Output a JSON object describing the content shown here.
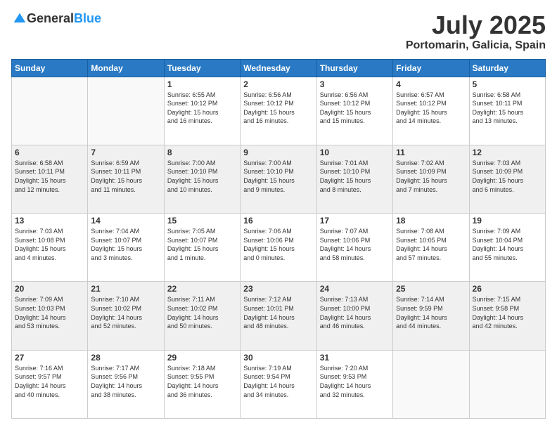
{
  "header": {
    "logo_general": "General",
    "logo_blue": "Blue",
    "month": "July 2025",
    "location": "Portomarin, Galicia, Spain"
  },
  "days_of_week": [
    "Sunday",
    "Monday",
    "Tuesday",
    "Wednesday",
    "Thursday",
    "Friday",
    "Saturday"
  ],
  "weeks": [
    [
      {
        "day": "",
        "info": ""
      },
      {
        "day": "",
        "info": ""
      },
      {
        "day": "1",
        "info": "Sunrise: 6:55 AM\nSunset: 10:12 PM\nDaylight: 15 hours\nand 16 minutes."
      },
      {
        "day": "2",
        "info": "Sunrise: 6:56 AM\nSunset: 10:12 PM\nDaylight: 15 hours\nand 16 minutes."
      },
      {
        "day": "3",
        "info": "Sunrise: 6:56 AM\nSunset: 10:12 PM\nDaylight: 15 hours\nand 15 minutes."
      },
      {
        "day": "4",
        "info": "Sunrise: 6:57 AM\nSunset: 10:12 PM\nDaylight: 15 hours\nand 14 minutes."
      },
      {
        "day": "5",
        "info": "Sunrise: 6:58 AM\nSunset: 10:11 PM\nDaylight: 15 hours\nand 13 minutes."
      }
    ],
    [
      {
        "day": "6",
        "info": "Sunrise: 6:58 AM\nSunset: 10:11 PM\nDaylight: 15 hours\nand 12 minutes."
      },
      {
        "day": "7",
        "info": "Sunrise: 6:59 AM\nSunset: 10:11 PM\nDaylight: 15 hours\nand 11 minutes."
      },
      {
        "day": "8",
        "info": "Sunrise: 7:00 AM\nSunset: 10:10 PM\nDaylight: 15 hours\nand 10 minutes."
      },
      {
        "day": "9",
        "info": "Sunrise: 7:00 AM\nSunset: 10:10 PM\nDaylight: 15 hours\nand 9 minutes."
      },
      {
        "day": "10",
        "info": "Sunrise: 7:01 AM\nSunset: 10:10 PM\nDaylight: 15 hours\nand 8 minutes."
      },
      {
        "day": "11",
        "info": "Sunrise: 7:02 AM\nSunset: 10:09 PM\nDaylight: 15 hours\nand 7 minutes."
      },
      {
        "day": "12",
        "info": "Sunrise: 7:03 AM\nSunset: 10:09 PM\nDaylight: 15 hours\nand 6 minutes."
      }
    ],
    [
      {
        "day": "13",
        "info": "Sunrise: 7:03 AM\nSunset: 10:08 PM\nDaylight: 15 hours\nand 4 minutes."
      },
      {
        "day": "14",
        "info": "Sunrise: 7:04 AM\nSunset: 10:07 PM\nDaylight: 15 hours\nand 3 minutes."
      },
      {
        "day": "15",
        "info": "Sunrise: 7:05 AM\nSunset: 10:07 PM\nDaylight: 15 hours\nand 1 minute."
      },
      {
        "day": "16",
        "info": "Sunrise: 7:06 AM\nSunset: 10:06 PM\nDaylight: 15 hours\nand 0 minutes."
      },
      {
        "day": "17",
        "info": "Sunrise: 7:07 AM\nSunset: 10:06 PM\nDaylight: 14 hours\nand 58 minutes."
      },
      {
        "day": "18",
        "info": "Sunrise: 7:08 AM\nSunset: 10:05 PM\nDaylight: 14 hours\nand 57 minutes."
      },
      {
        "day": "19",
        "info": "Sunrise: 7:09 AM\nSunset: 10:04 PM\nDaylight: 14 hours\nand 55 minutes."
      }
    ],
    [
      {
        "day": "20",
        "info": "Sunrise: 7:09 AM\nSunset: 10:03 PM\nDaylight: 14 hours\nand 53 minutes."
      },
      {
        "day": "21",
        "info": "Sunrise: 7:10 AM\nSunset: 10:02 PM\nDaylight: 14 hours\nand 52 minutes."
      },
      {
        "day": "22",
        "info": "Sunrise: 7:11 AM\nSunset: 10:02 PM\nDaylight: 14 hours\nand 50 minutes."
      },
      {
        "day": "23",
        "info": "Sunrise: 7:12 AM\nSunset: 10:01 PM\nDaylight: 14 hours\nand 48 minutes."
      },
      {
        "day": "24",
        "info": "Sunrise: 7:13 AM\nSunset: 10:00 PM\nDaylight: 14 hours\nand 46 minutes."
      },
      {
        "day": "25",
        "info": "Sunrise: 7:14 AM\nSunset: 9:59 PM\nDaylight: 14 hours\nand 44 minutes."
      },
      {
        "day": "26",
        "info": "Sunrise: 7:15 AM\nSunset: 9:58 PM\nDaylight: 14 hours\nand 42 minutes."
      }
    ],
    [
      {
        "day": "27",
        "info": "Sunrise: 7:16 AM\nSunset: 9:57 PM\nDaylight: 14 hours\nand 40 minutes."
      },
      {
        "day": "28",
        "info": "Sunrise: 7:17 AM\nSunset: 9:56 PM\nDaylight: 14 hours\nand 38 minutes."
      },
      {
        "day": "29",
        "info": "Sunrise: 7:18 AM\nSunset: 9:55 PM\nDaylight: 14 hours\nand 36 minutes."
      },
      {
        "day": "30",
        "info": "Sunrise: 7:19 AM\nSunset: 9:54 PM\nDaylight: 14 hours\nand 34 minutes."
      },
      {
        "day": "31",
        "info": "Sunrise: 7:20 AM\nSunset: 9:53 PM\nDaylight: 14 hours\nand 32 minutes."
      },
      {
        "day": "",
        "info": ""
      },
      {
        "day": "",
        "info": ""
      }
    ]
  ]
}
